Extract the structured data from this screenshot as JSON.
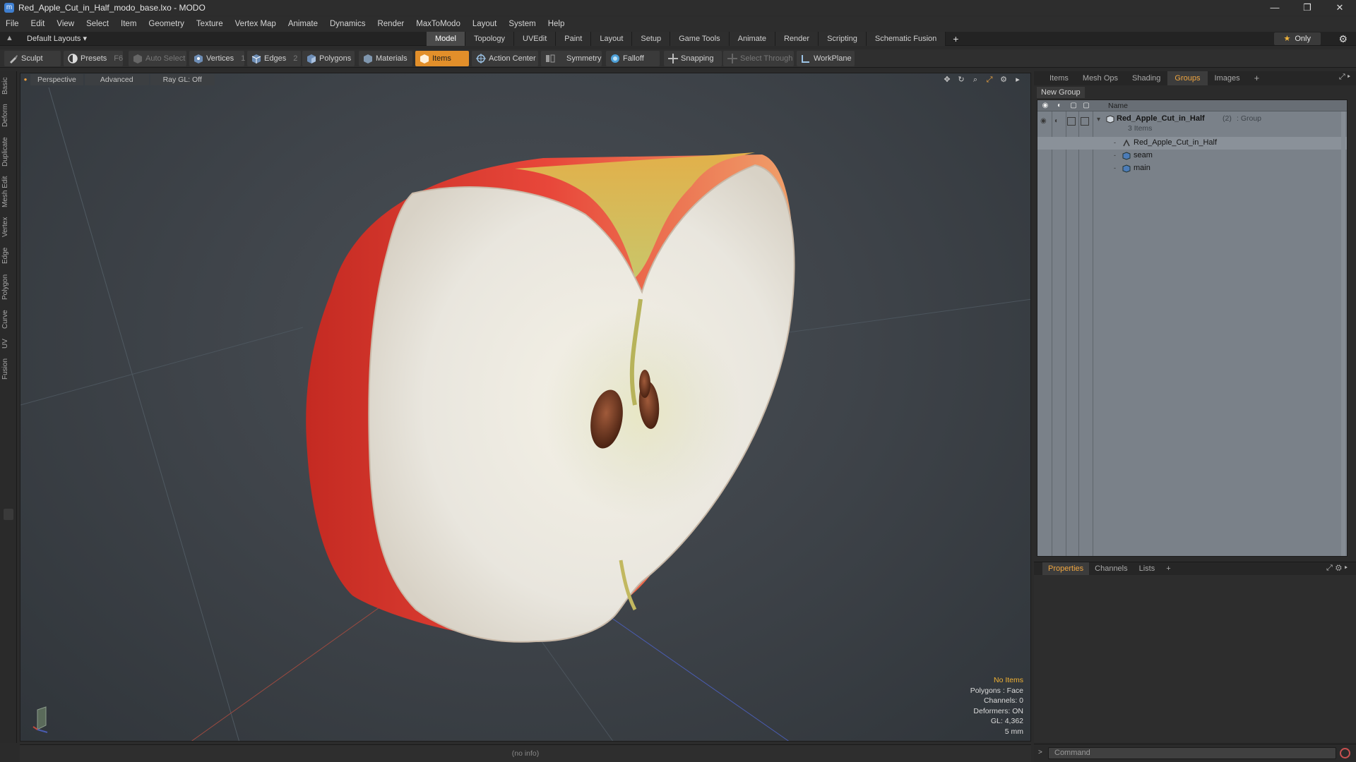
{
  "window": {
    "title": "Red_Apple_Cut_in_Half_modo_base.lxo - MODO",
    "controls": [
      "—",
      "❐",
      "✕"
    ]
  },
  "menu": [
    "File",
    "Edit",
    "View",
    "Select",
    "Item",
    "Geometry",
    "Texture",
    "Vertex Map",
    "Animate",
    "Dynamics",
    "Render",
    "MaxToModo",
    "Layout",
    "System",
    "Help"
  ],
  "layoutbar": {
    "default_layouts": "Default Layouts ▾",
    "tabs": [
      "Model",
      "Topology",
      "UVEdit",
      "Paint",
      "Layout",
      "Setup",
      "Game Tools",
      "Animate",
      "Render",
      "Scripting",
      "Schematic Fusion"
    ],
    "active_tab": "Model",
    "plus": "+",
    "only_label": "Only"
  },
  "toolbar": {
    "sculpt": "Sculpt",
    "presets": "Presets",
    "presets_key": "F6",
    "auto_select": "Auto Select",
    "vertices": "Vertices",
    "vertices_count": "1",
    "edges": "Edges",
    "edges_count": "2",
    "polygons": "Polygons",
    "materials": "Materials",
    "items": "Items",
    "action_center": "Action Center",
    "symmetry": "Symmetry",
    "falloff": "Falloff",
    "snapping": "Snapping",
    "select_through": "Select Through",
    "workplane": "WorkPlane"
  },
  "left_tabs": [
    "Basic",
    "Deform",
    "Duplicate",
    "Mesh Edit",
    "Vertex",
    "Edge",
    "Polygon",
    "Curve",
    "UV",
    "Fusion"
  ],
  "viewport": {
    "view": "Perspective",
    "advanced": "Advanced",
    "raygl": "Ray GL: Off",
    "stats": {
      "no_items": "No Items",
      "polygons": "Polygons : Face",
      "channels": "Channels: 0",
      "deformers": "Deformers: ON",
      "gl": "GL: 4,362",
      "scale": "5 mm"
    }
  },
  "status": {
    "info": "(no info)"
  },
  "right_panel": {
    "tabs": [
      "Items",
      "Mesh Ops",
      "Shading",
      "Groups",
      "Images"
    ],
    "active_tab": "Groups",
    "plus": "+",
    "new_group": "New Group",
    "column_name": "Name",
    "group": {
      "name": "Red_Apple_Cut_in_Half",
      "count": "(2)",
      "type": ": Group",
      "items_count": "3 Items",
      "children": [
        "Red_Apple_Cut_in_Half",
        "seam",
        "main"
      ]
    }
  },
  "properties_panel": {
    "tabs": [
      "Properties",
      "Channels",
      "Lists"
    ],
    "active_tab": "Properties",
    "plus": "+"
  },
  "command": {
    "placeholder": "Command"
  },
  "colors": {
    "accent": "#e28f2a",
    "active_tab_text": "#f0a640",
    "stat_highlight": "#f0b133",
    "apple_skin": "#d43a2c",
    "apple_flesh": "#ecebe4"
  }
}
